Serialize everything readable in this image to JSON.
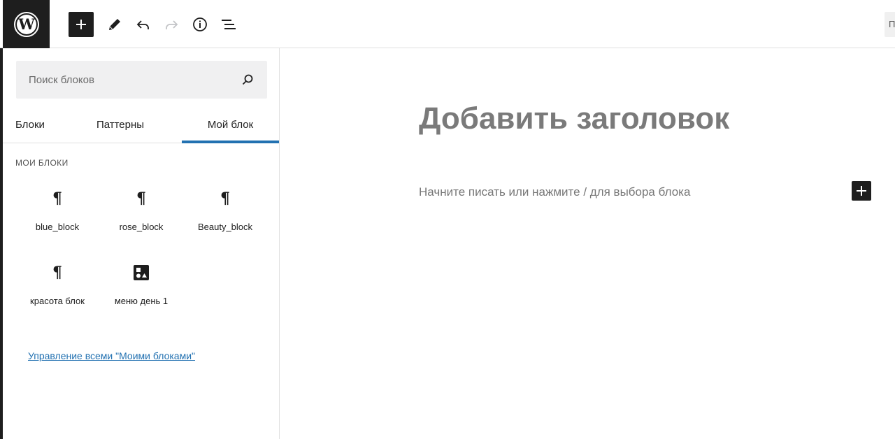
{
  "toolbar": {
    "logo_icon": "wordpress-logo-icon",
    "add_icon": "plus-icon",
    "edit_icon": "pencil-icon",
    "undo_icon": "undo-icon",
    "redo_icon": "redo-icon",
    "info_icon": "info-icon",
    "list_view_icon": "list-view-icon",
    "preview_label": "П"
  },
  "inserter": {
    "search_placeholder": "Поиск блоков",
    "search_icon": "search-icon",
    "tabs": [
      {
        "label": "Блоки"
      },
      {
        "label": "Паттерны"
      },
      {
        "label": "Мой блок"
      }
    ],
    "active_tab": "Мой блок",
    "section_title": "Мои блоки",
    "blocks": [
      {
        "label": "blue_block",
        "icon": "paragraph-icon"
      },
      {
        "label": "rose_block",
        "icon": "paragraph-icon"
      },
      {
        "label": "Beauty_block",
        "icon": "paragraph-icon"
      },
      {
        "label": "красота блок",
        "icon": "paragraph-icon"
      },
      {
        "label": "меню день 1",
        "icon": "media-text-icon"
      }
    ],
    "manage_link": "Управление всеми \"Моими блоками\""
  },
  "editor": {
    "title_placeholder": "Добавить заголовок",
    "paragraph_placeholder": "Начните писать или нажмите / для выбора блока",
    "add_block_icon": "plus-icon"
  },
  "colors": {
    "dark": "#1e1e1e",
    "accent": "#2271b1",
    "search_bg": "#f0f0f1"
  }
}
